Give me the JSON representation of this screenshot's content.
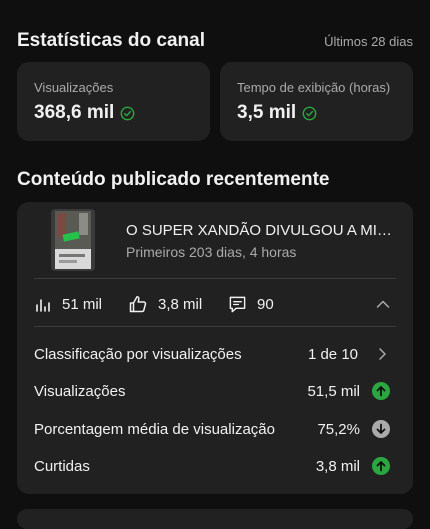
{
  "channel_stats": {
    "title": "Estatísticas do canal",
    "period": "Últimos 28 dias",
    "cards": [
      {
        "label": "Visualizações",
        "value": "368,6 mil"
      },
      {
        "label": "Tempo de exibição (horas)",
        "value": "3,5 mil"
      }
    ]
  },
  "recent": {
    "title": "Conteúdo publicado recentemente",
    "video": {
      "title": "O SUPER XANDÃO DIVULGOU A MINHA...",
      "subtitle": "Primeiros 203 dias, 4 horas",
      "views": "51 mil",
      "likes": "3,8 mil",
      "comments": "90"
    },
    "details": [
      {
        "label": "Classificação por visualizações",
        "value": "1 de 10",
        "icon": "chevron-right-icon"
      },
      {
        "label": "Visualizações",
        "value": "51,5 mil",
        "icon": "arrow-up-icon"
      },
      {
        "label": "Porcentagem média de visualização",
        "value": "75,2%",
        "icon": "arrow-down-icon"
      },
      {
        "label": "Curtidas",
        "value": "3,8 mil",
        "icon": "arrow-up-icon"
      }
    ]
  },
  "colors": {
    "background": "#0f0f0f",
    "card": "#212121",
    "positive": "#2ba640",
    "neutral": "#aaaaaa"
  }
}
